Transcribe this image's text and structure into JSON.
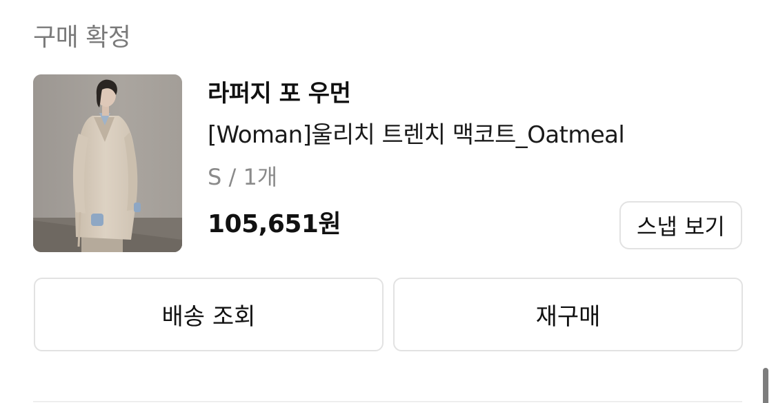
{
  "order": {
    "status": "구매 확정",
    "product": {
      "image": "product-photo",
      "brand": "라퍼지 포 우먼",
      "name": "[Woman]울리치 트렌치 맥코트_Oatmeal",
      "option": "S / 1개",
      "price": "105,651원"
    },
    "snap_button_label": "스냅 보기",
    "actions": {
      "delivery_label": "배송 조회",
      "rebuy_label": "재구매"
    }
  },
  "colors": {
    "status_text": "#7a7a7a",
    "primary_text": "#111111",
    "secondary_text": "#8a8a8a",
    "border": "#e2e2e2"
  }
}
